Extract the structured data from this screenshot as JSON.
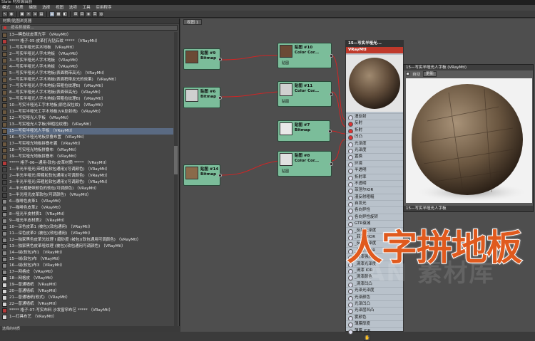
{
  "window": {
    "title": "Slate 材质编辑器"
  },
  "menu": [
    "模式",
    "材质",
    "编辑",
    "选择",
    "视图",
    "选项",
    "工具",
    "实用程序"
  ],
  "browser": {
    "title": "材质/贴图浏览器",
    "search_placeholder": "按名称搜索...",
    "items": [
      "13—鳄鱼纹皮革光字    （VRayMtl）",
      "***** 格子-05-皮革打光钻石纹 *****    （VRayMtl）",
      "1—写实半哑光实木地板    （VRayMtl）",
      "2—写实半哑光人字木地板    （VRayMtl）",
      "3—写实半哑光人字木地板    （VRayMtl）",
      "4—写实半哑光人字木地板    （VRayMtl）",
      "5—写实半哑光人字木地板(表面稍带高光)    （VRayMtl）",
      "6—写实半哑光人字木地板(表面稍带反光的效果)    （VRayMtl）",
      "7—写实半哑光人字木地板(带粗拉纹理B)    （VRayMtl）",
      "8—写实半哑光人字木地板(表面带高光)    （VRayMtl）",
      "9—写实半哑光人字木地板(带粗拉纹理B)    （VRayMtl）",
      "10—写实半哑光工字木地板(原色双拉纹)    （VRayMtl）",
      "11—写实半哑光工字木地板(VR反射线)    （VRayMtl）",
      "12—写实哑光人字板    （VRayMtl）",
      "13—写实哑光人字板(带粗拉纹理)    （VRayMtl）",
      "15—写实半哑光人字板    （VRayMtl）",
      "16—写实半哑光地板拼叠布置    （VRayMtl）",
      "17—写实哑光地板拼叠布置    （VRayMtl）",
      "18—写实哑光地板拼叠布    （VRayMtl）",
      "19—写实哑光地板拼叠布    （VRayMtl）",
      "***** 格子-06—通用-软包-皮革材质 *****    （VRayMtl）",
      "1—半光半哑光(带粗粒软包通用)(可调颜色)    （VRayMtl）",
      "2—半光半哑光(带粗粒软包通用)(可调颜色)    （VRayMtl）",
      "3—半光半哑光(带粗粒软包通用)(可调颜色)    （VRayMtl）",
      "4—半光粗糙带颜色的软包(可调颜色)    （VRayMtl）",
      "5—半光哑光皮革软包(可调颜色)    （VRayMtl）",
      "6—咖啡色皮革1    （VRayMtl）",
      "7—咖啡色皮革2    （VRayMtl）",
      "8—哑光半皮材质1    （VRayMtl）",
      "9—哑光半皮材质2    （VRayMtl）",
      "10—深色皮革1  (被包)(软包通用)    （VRayMtl）",
      "11—深色皮革2  (被包)(软包通用)    （VRayMtl）",
      "12—独家黑色皮革光纹理 I 磨砂度    (被包)(软包通用可调颜色)    （VRayMtl）",
      "13—独家黑色皮革哑纹理    (被包)(软包通用可调颜色)    （VRayMtl）",
      "14—绒(软包)布1    （VRayMtl）",
      "15—绒(软包)布    （VRayMtl）",
      "16—绒(软包)布3    （VRayMtl）",
      "17—网格皮    （VRayMtl）",
      "18—网格皮    （VRayMtl）",
      "19—普通墙纸    （VRayMtl）",
      "20—普通墙纸    （VRayMtl）",
      "21—普通墙纸(软式)    （VRayMtl）",
      "22—普通墙纸    （VRayMtl）",
      "***** 格子-07-写实布料 沙发窗帘布艺 *****    （VRayMtl）",
      "1—灯具布艺    （VRayMtl）"
    ],
    "status": "选择的材质"
  },
  "view": {
    "tab_label": "视图 1"
  },
  "nodes": {
    "bmp9": {
      "title": "贴图 #9",
      "type": "Bitmap"
    },
    "bmp6": {
      "title": "贴图 #6",
      "type": "Bitmap"
    },
    "bmp14": {
      "title": "贴图 #14",
      "type": "Bitmap"
    },
    "bmp7": {
      "title": "贴图 #7",
      "type": "Bitmap"
    },
    "cc10": {
      "title": "贴图 #10",
      "type": "Color Cor...",
      "port": "贴图"
    },
    "cc11": {
      "title": "贴图 #11",
      "type": "Color Cor...",
      "port": "贴图"
    },
    "cc8": {
      "title": "贴图 #8",
      "type": "Color Cor...",
      "port": "贴图"
    }
  },
  "vray_node": {
    "title": "15—写实半哑光...",
    "subtitle": "VRayMtl",
    "slots": [
      "漫反射",
      "反射",
      "折射",
      "凹凸",
      "光泽度",
      "光泽度",
      "置换",
      "环境",
      "半透明",
      "折射率",
      "不透明",
      "菲涅尔IOR",
      "漫反射粗糙",
      "自发光",
      "各向异性",
      "各向异性旋转",
      "GTR衰减",
      "_反射光泽度",
      "_菲涅尔IOR",
      "_反射光泽度",
      "_菲涅尔IOR",
      "_清漆强度",
      "_清漆光泽度",
      "_清漆 IOR",
      "_清漆颜色",
      "_清漆凹凸",
      "光泽光泽度",
      "光泽颜色",
      "光泽凹凸",
      "光泽层凹凸",
      "雾颜色",
      "薄膜厚度",
      "薄膜 IOR"
    ],
    "active_slots": [
      1,
      2,
      3
    ]
  },
  "preview": {
    "title": "15—写实半哑光人字板 (VRayMtl)",
    "auto_label": "自动",
    "update_label": "更新",
    "footer": "15—写实半哑光人字板"
  },
  "overlay": {
    "caption": "人字拼地板",
    "watermark": "AN 素材库",
    "logo": "AN"
  }
}
